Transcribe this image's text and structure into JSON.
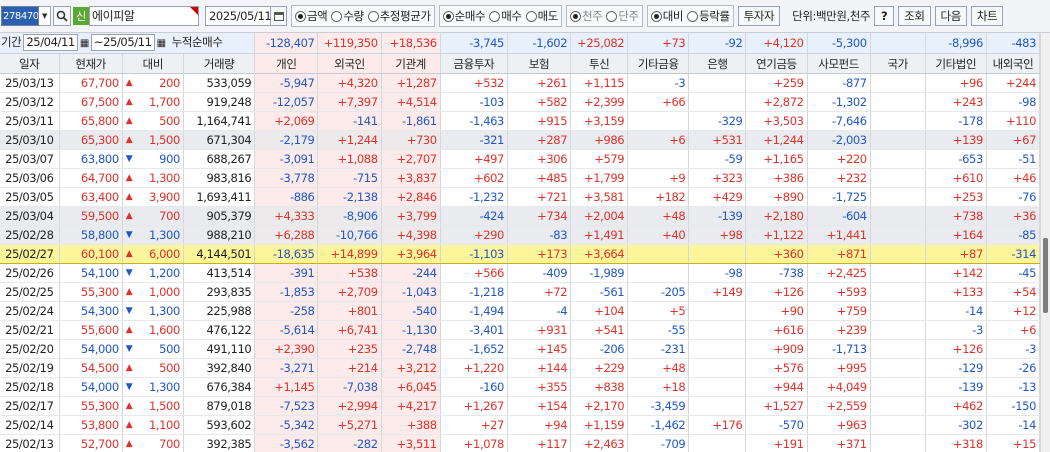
{
  "toolbar": {
    "code": "278470",
    "sin_badge": "신",
    "stock_name": "에이피알",
    "date": "2025/05/11",
    "radio_groups": [
      [
        {
          "label": "금액",
          "on": true
        },
        {
          "label": "수량",
          "on": false
        },
        {
          "label": "추정평균가",
          "on": false
        }
      ],
      [
        {
          "label": "순매수",
          "on": true
        },
        {
          "label": "매수",
          "on": false
        },
        {
          "label": "매도",
          "on": false
        }
      ],
      [
        {
          "label": "천주",
          "on": true,
          "dis": true
        },
        {
          "label": "단주",
          "on": false,
          "dis": true
        }
      ],
      [
        {
          "label": "대비",
          "on": true
        },
        {
          "label": "등락률",
          "on": false
        }
      ]
    ],
    "investor_btn": "투자자",
    "unit_label": "단위:백만원,천주",
    "help_btn": "?",
    "query_btn": "조회",
    "next_btn": "다음",
    "chart_btn": "차트"
  },
  "summary": {
    "period_label": "기간",
    "from": "25/04/11",
    "to": "~25/05/11",
    "cum_label": "누적순매수",
    "values": [
      "-128,407",
      "+119,350",
      "+18,536",
      "-3,745",
      "-1,602",
      "+25,082",
      "+73",
      "-92",
      "+4,120",
      "-5,300",
      "",
      "-8,996",
      "-483"
    ]
  },
  "headers": [
    "일자",
    "현재가",
    "대비",
    "거래량",
    "개인",
    "외국인",
    "기관계",
    "금융투자",
    "보험",
    "투신",
    "기타금융",
    "은행",
    "연기금등",
    "사모펀드",
    "국가",
    "기타법인",
    "내외국인"
  ],
  "rows": [
    {
      "d": "25/03/13",
      "p": "67,700",
      "dir": "up",
      "c": "200",
      "v": "533,059",
      "vals": [
        "-5,947",
        "+4,320",
        "+1,287",
        "+532",
        "+261",
        "+1,115",
        "-3",
        "",
        "+259",
        "-877",
        "",
        "+96",
        "+244"
      ]
    },
    {
      "d": "25/03/12",
      "p": "67,500",
      "dir": "up",
      "c": "1,700",
      "v": "919,248",
      "vals": [
        "-12,057",
        "+7,397",
        "+4,514",
        "-103",
        "+582",
        "+2,399",
        "+66",
        "",
        "+2,872",
        "-1,302",
        "",
        "+243",
        "-98"
      ]
    },
    {
      "d": "25/03/11",
      "p": "65,800",
      "dir": "up",
      "c": "500",
      "v": "1,164,741",
      "vals": [
        "+2,069",
        "-141",
        "-1,861",
        "-1,463",
        "+915",
        "+3,159",
        "",
        "-329",
        "+3,503",
        "-7,646",
        "",
        "-178",
        "+110"
      ]
    },
    {
      "d": "25/03/10",
      "p": "65,300",
      "dir": "up",
      "c": "1,500",
      "v": "671,304",
      "vals": [
        "-2,179",
        "+1,244",
        "+730",
        "-321",
        "+287",
        "+986",
        "+6",
        "+531",
        "+1,244",
        "-2,003",
        "",
        "+139",
        "+67"
      ]
    },
    {
      "d": "25/03/07",
      "p": "63,800",
      "dir": "down",
      "c": "900",
      "v": "688,267",
      "vals": [
        "-3,091",
        "+1,088",
        "+2,707",
        "+497",
        "+306",
        "+579",
        "",
        "-59",
        "+1,165",
        "+220",
        "",
        "-653",
        "-51"
      ]
    },
    {
      "d": "25/03/06",
      "p": "64,700",
      "dir": "up",
      "c": "1,300",
      "v": "983,816",
      "vals": [
        "-3,778",
        "-715",
        "+3,837",
        "+602",
        "+485",
        "+1,799",
        "+9",
        "+323",
        "+386",
        "+232",
        "",
        "+610",
        "+46"
      ]
    },
    {
      "d": "25/03/05",
      "p": "63,400",
      "dir": "up",
      "c": "3,900",
      "v": "1,693,411",
      "vals": [
        "-886",
        "-2,138",
        "+2,846",
        "-1,232",
        "+721",
        "+3,581",
        "+182",
        "+429",
        "+890",
        "-1,725",
        "",
        "+253",
        "-76"
      ]
    },
    {
      "d": "25/03/04",
      "p": "59,500",
      "dir": "up",
      "c": "700",
      "v": "905,379",
      "vals": [
        "+4,333",
        "-8,906",
        "+3,799",
        "-424",
        "+734",
        "+2,004",
        "+48",
        "-139",
        "+2,180",
        "-604",
        "",
        "+738",
        "+36"
      ]
    },
    {
      "d": "25/02/28",
      "p": "58,800",
      "dir": "down",
      "c": "1,300",
      "v": "988,210",
      "vals": [
        "+6,288",
        "-10,766",
        "+4,398",
        "+290",
        "-83",
        "+1,491",
        "+40",
        "+98",
        "+1,122",
        "+1,441",
        "",
        "+164",
        "-85"
      ]
    },
    {
      "d": "25/02/27",
      "p": "60,100",
      "dir": "up",
      "c": "6,000",
      "v": "4,144,501",
      "vals": [
        "-18,635",
        "+14,899",
        "+3,964",
        "-1,103",
        "+173",
        "+3,664",
        "",
        "",
        "+360",
        "+871",
        "",
        "+87",
        "-314"
      ],
      "sel": true
    },
    {
      "d": "25/02/26",
      "p": "54,100",
      "dir": "down",
      "c": "1,200",
      "v": "413,514",
      "vals": [
        "-391",
        "+538",
        "-244",
        "+566",
        "-409",
        "-1,989",
        "",
        "-98",
        "-738",
        "+2,425",
        "",
        "+142",
        "-45"
      ]
    },
    {
      "d": "25/02/25",
      "p": "55,300",
      "dir": "up",
      "c": "1,000",
      "v": "293,835",
      "vals": [
        "-1,853",
        "+2,709",
        "-1,043",
        "-1,218",
        "+72",
        "-561",
        "-205",
        "+149",
        "+126",
        "+593",
        "",
        "+133",
        "+54"
      ]
    },
    {
      "d": "25/02/24",
      "p": "54,300",
      "dir": "down",
      "c": "1,300",
      "v": "225,988",
      "vals": [
        "-258",
        "+801",
        "-540",
        "-1,494",
        "-4",
        "+104",
        "+5",
        "",
        "+90",
        "+759",
        "",
        "-14",
        "+12"
      ]
    },
    {
      "d": "25/02/21",
      "p": "55,600",
      "dir": "up",
      "c": "1,600",
      "v": "476,122",
      "vals": [
        "-5,614",
        "+6,741",
        "-1,130",
        "-3,401",
        "+931",
        "+541",
        "-55",
        "",
        "+616",
        "+239",
        "",
        "-3",
        "+6"
      ]
    },
    {
      "d": "25/02/20",
      "p": "54,000",
      "dir": "down",
      "c": "500",
      "v": "491,110",
      "vals": [
        "+2,390",
        "+235",
        "-2,748",
        "-1,652",
        "+145",
        "-206",
        "-231",
        "",
        "+909",
        "-1,713",
        "",
        "+126",
        "-3"
      ]
    },
    {
      "d": "25/02/19",
      "p": "54,500",
      "dir": "up",
      "c": "500",
      "v": "392,840",
      "vals": [
        "-3,271",
        "+214",
        "+3,212",
        "+1,220",
        "+144",
        "+229",
        "+48",
        "",
        "+576",
        "+995",
        "",
        "-129",
        "-26"
      ]
    },
    {
      "d": "25/02/18",
      "p": "54,000",
      "dir": "down",
      "c": "1,300",
      "v": "676,384",
      "vals": [
        "+1,145",
        "-7,038",
        "+6,045",
        "-160",
        "+355",
        "+838",
        "+18",
        "",
        "+944",
        "+4,049",
        "",
        "-139",
        "-13"
      ]
    },
    {
      "d": "25/02/17",
      "p": "55,300",
      "dir": "up",
      "c": "1,500",
      "v": "879,018",
      "vals": [
        "-7,523",
        "+2,994",
        "+4,217",
        "+1,267",
        "+154",
        "+2,170",
        "-3,459",
        "",
        "+1,527",
        "+2,559",
        "",
        "+462",
        "-150"
      ]
    },
    {
      "d": "25/02/14",
      "p": "53,800",
      "dir": "up",
      "c": "1,100",
      "v": "593,602",
      "vals": [
        "-5,342",
        "+5,271",
        "+388",
        "+27",
        "+94",
        "+1,159",
        "-1,462",
        "+176",
        "-570",
        "+963",
        "",
        "-302",
        "-14"
      ]
    },
    {
      "d": "25/02/13",
      "p": "52,700",
      "dir": "up",
      "c": "700",
      "v": "392,385",
      "vals": [
        "-3,562",
        "-282",
        "+3,511",
        "+1,078",
        "+117",
        "+2,463",
        "-709",
        "",
        "+191",
        "+371",
        "",
        "+318",
        "+15"
      ]
    }
  ],
  "colors": {
    "up": "#e0312b",
    "down": "#1f57c8",
    "selected": "#fdf59a",
    "investor_bg": "#fcebea"
  }
}
